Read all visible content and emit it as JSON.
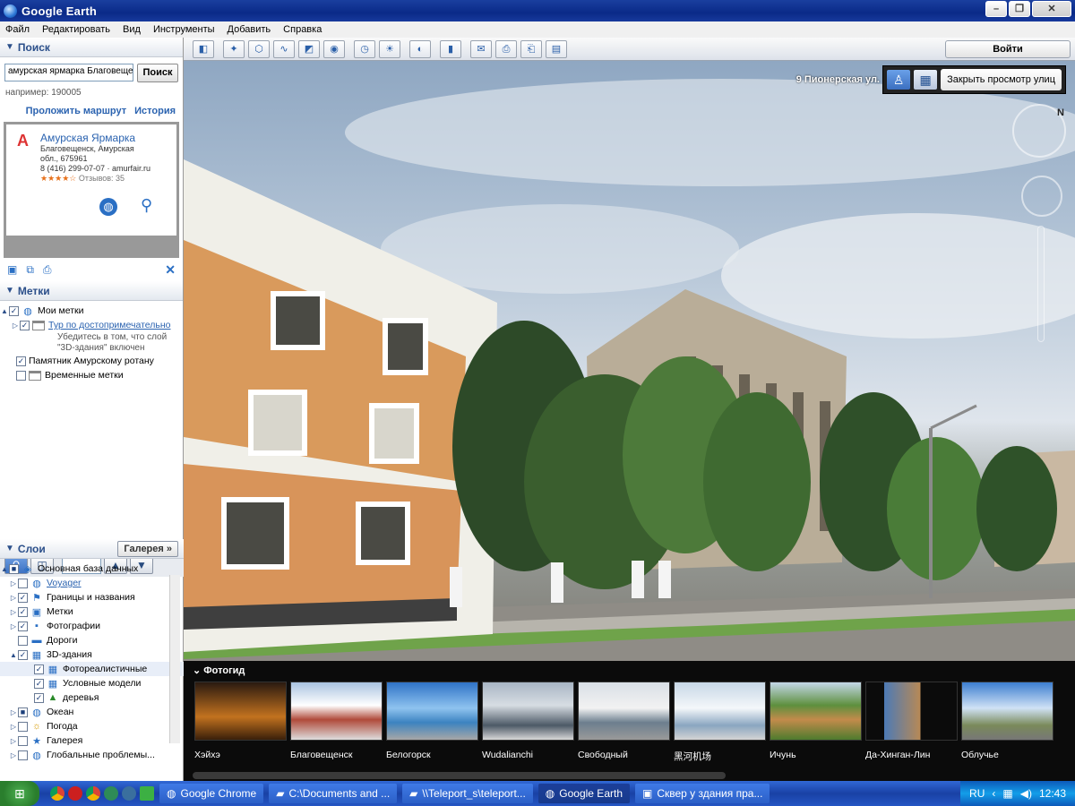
{
  "window": {
    "title": "Google Earth"
  },
  "menu": [
    "Файл",
    "Редактировать",
    "Вид",
    "Инструменты",
    "Добавить",
    "Справка"
  ],
  "search": {
    "header": "Поиск",
    "query": "амурская ярмарка Благовеще",
    "button": "Поиск",
    "example": "например: 190005",
    "route_link": "Проложить маршрут",
    "history_link": "История",
    "result": {
      "marker": "A",
      "name": "Амурская Ярмарка",
      "address1": "Благовещенск, Амурская",
      "address2": "обл., 675961",
      "phone_site": "8 (416) 299-07-07 · amurfair.ru",
      "stars": "★★★★☆",
      "reviews": "Отзывов: 35"
    }
  },
  "places": {
    "header": "Метки",
    "items": [
      {
        "label": "Мои метки"
      },
      {
        "label": "Тур по достопримечательно"
      },
      {
        "note1": "Убедитесь в том, что слой",
        "note2": "\"3D-здания\" включен"
      },
      {
        "label": "Памятник Амурскому ротану"
      },
      {
        "label": "Временные метки"
      }
    ]
  },
  "layers": {
    "header": "Слои",
    "gallery_button": "Галерея »",
    "items": [
      {
        "label": "Основная база данных"
      },
      {
        "label": "Voyager"
      },
      {
        "label": "Границы и названия"
      },
      {
        "label": "Метки"
      },
      {
        "label": "Фотографии"
      },
      {
        "label": "Дороги"
      },
      {
        "label": "3D-здания"
      },
      {
        "label": "Фотореалистичные"
      },
      {
        "label": "Условные модели"
      },
      {
        "label": "деревья"
      },
      {
        "label": "Океан"
      },
      {
        "label": "Погода"
      },
      {
        "label": "Галерея"
      },
      {
        "label": "Глобальные проблемы..."
      }
    ]
  },
  "toolbar": {
    "login": "Войти"
  },
  "streetview": {
    "street_label": "9 Пионерская ул.",
    "close_button": "Закрыть просмотр улиц"
  },
  "tour": {
    "title": "Фотогид",
    "places": [
      "Хэйхэ",
      "Благовещенск",
      "Белогорск",
      "Wudalianchi",
      "Свободный",
      "黑河机场",
      "Ичунь",
      "Да-Хинган-Лин",
      "Облучье"
    ]
  },
  "taskbar": {
    "tasks": [
      "Google Chrome",
      "C:\\Documents and ...",
      "\\\\Teleport_s\\teleport...",
      "Google Earth",
      "Сквер у здания пра..."
    ],
    "lang": "RU",
    "time": "12:43"
  }
}
